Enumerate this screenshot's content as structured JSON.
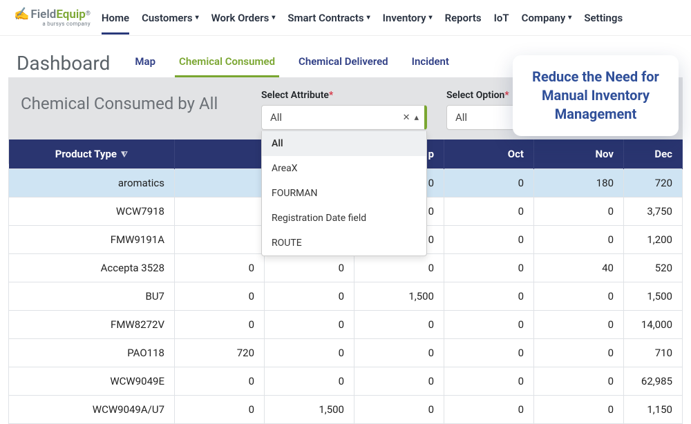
{
  "brand": {
    "field": "Field",
    "equip": "Equip",
    "reg": "®",
    "sub": "a bursys company"
  },
  "nav": {
    "items": [
      {
        "label": "Home",
        "dropdown": false,
        "active": true
      },
      {
        "label": "Customers",
        "dropdown": true
      },
      {
        "label": "Work Orders",
        "dropdown": true
      },
      {
        "label": "Smart Contracts",
        "dropdown": true
      },
      {
        "label": "Inventory",
        "dropdown": true
      },
      {
        "label": "Reports",
        "dropdown": false
      },
      {
        "label": "IoT",
        "dropdown": false
      },
      {
        "label": "Company",
        "dropdown": true
      },
      {
        "label": "Settings",
        "dropdown": false
      }
    ]
  },
  "page_title": "Dashboard",
  "tabs": [
    {
      "label": "Map",
      "active": false
    },
    {
      "label": "Chemical Consumed",
      "active": true
    },
    {
      "label": "Chemical Delivered",
      "active": false
    },
    {
      "label": "Incident",
      "active": false
    }
  ],
  "section_title": "Chemical Consumed by All",
  "filters": {
    "attribute": {
      "label": "Select Attribute",
      "value": "All",
      "options": [
        "All",
        "AreaX",
        "FOURMAN",
        "Registration Date field",
        "ROUTE"
      ]
    },
    "option": {
      "label": "Select Option",
      "value": "All"
    }
  },
  "callout": "Reduce the Need for Manual Inventory Management",
  "table": {
    "headers": [
      "Product Type",
      "",
      "",
      "Sep",
      "Oct",
      "Nov",
      "Dec"
    ],
    "rows": [
      {
        "type": "aromatics",
        "c2": "",
        "c3": "",
        "sep": "0",
        "oct": "0",
        "nov": "180",
        "dec": "720",
        "hl": true
      },
      {
        "type": "WCW7918",
        "c2": "",
        "c3": "",
        "sep": "0",
        "oct": "0",
        "nov": "0",
        "dec": "3,750"
      },
      {
        "type": "FMW9191A",
        "c2": "",
        "c3": "",
        "sep": "0",
        "oct": "0",
        "nov": "0",
        "dec": "1,200"
      },
      {
        "type": "Accepta 3528",
        "c2": "0",
        "c3": "0",
        "sep": "0",
        "oct": "0",
        "nov": "40",
        "dec": "520"
      },
      {
        "type": "BU7",
        "c2": "0",
        "c3": "0",
        "sep": "1,500",
        "oct": "0",
        "nov": "0",
        "dec": "1,500"
      },
      {
        "type": "FMW8272V",
        "c2": "0",
        "c3": "0",
        "sep": "0",
        "oct": "0",
        "nov": "0",
        "dec": "14,000"
      },
      {
        "type": "PAO118",
        "c2": "720",
        "c3": "0",
        "sep": "0",
        "oct": "0",
        "nov": "0",
        "dec": "710"
      },
      {
        "type": "WCW9049E",
        "c2": "0",
        "c3": "0",
        "sep": "0",
        "oct": "0",
        "nov": "0",
        "dec": "62,985"
      },
      {
        "type": "WCW9049A/U7",
        "c2": "0",
        "c3": "1,500",
        "sep": "0",
        "oct": "0",
        "nov": "0",
        "dec": "1,150"
      }
    ]
  }
}
